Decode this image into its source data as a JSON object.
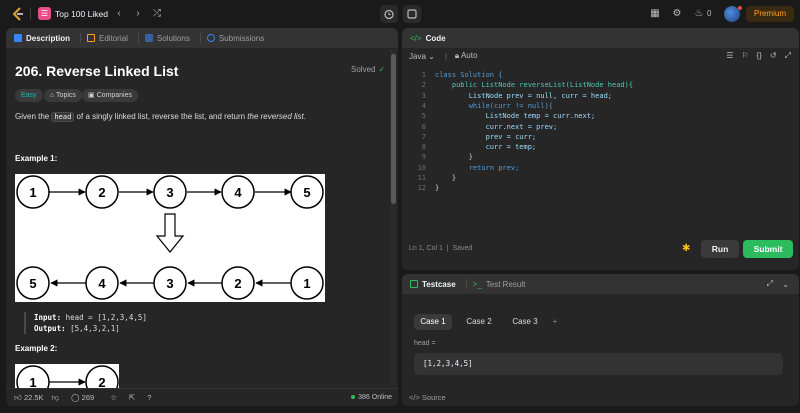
{
  "topbar": {
    "list_title": "Top 100 Liked",
    "flame_count": "0",
    "premium_label": "Premium"
  },
  "left_tabs": [
    {
      "label": "Description"
    },
    {
      "label": "Editorial"
    },
    {
      "label": "Solutions"
    },
    {
      "label": "Submissions"
    }
  ],
  "problem": {
    "title": "206. Reverse Linked List",
    "status": "Solved",
    "tags": [
      "Easy",
      "Topics",
      "Companies"
    ],
    "desc_prefix": "Given the ",
    "desc_code": "head",
    "desc_middle": " of a singly linked list, reverse the list, and return ",
    "desc_em": "the reversed list",
    "desc_suffix": ".",
    "example1_title": "Example 1:",
    "example2_title": "Example 2:",
    "input_label": "Input:",
    "input_value": "head = [1,2,3,4,5]",
    "output_label": "Output:",
    "output_value": "[5,4,3,2,1]",
    "list_top": [
      "1",
      "2",
      "3",
      "4",
      "5"
    ],
    "list_bottom": [
      "5",
      "4",
      "3",
      "2",
      "1"
    ],
    "list_ex2": [
      "1",
      "2"
    ]
  },
  "left_footer": {
    "likes": "22.5K",
    "comments": "269",
    "online": "386 Online"
  },
  "code_panel": {
    "title": "Code",
    "language": "Java",
    "auto_label": "Auto",
    "lines": [
      "class Solution {",
      "    public ListNode reverseList(ListNode head){",
      "        ListNode prev = null, curr = head;",
      "        while(curr != null){",
      "            ListNode temp = curr.next;",
      "            curr.next = prev;",
      "            prev = curr;",
      "            curr = temp;",
      "        }",
      "        return prev;",
      "    }",
      "}"
    ],
    "line_numbers": [
      "1",
      "2",
      "3",
      "4",
      "5",
      "6",
      "7",
      "8",
      "9",
      "10",
      "11",
      "12"
    ],
    "status": "Ln 1, Col 1",
    "saved": "Saved",
    "run_label": "Run",
    "submit_label": "Submit"
  },
  "test_panel": {
    "tab_testcase": "Testcase",
    "tab_result": "Test Result",
    "cases": [
      "Case 1",
      "Case 2",
      "Case 3"
    ],
    "add_label": "+",
    "param_label": "head =",
    "param_value": "[1,2,3,4,5]",
    "source_label": "Source"
  },
  "colors": {
    "accent_green": "#2cbb5d",
    "easy_teal": "#1cbaba",
    "premium_orange": "#ffa116"
  }
}
